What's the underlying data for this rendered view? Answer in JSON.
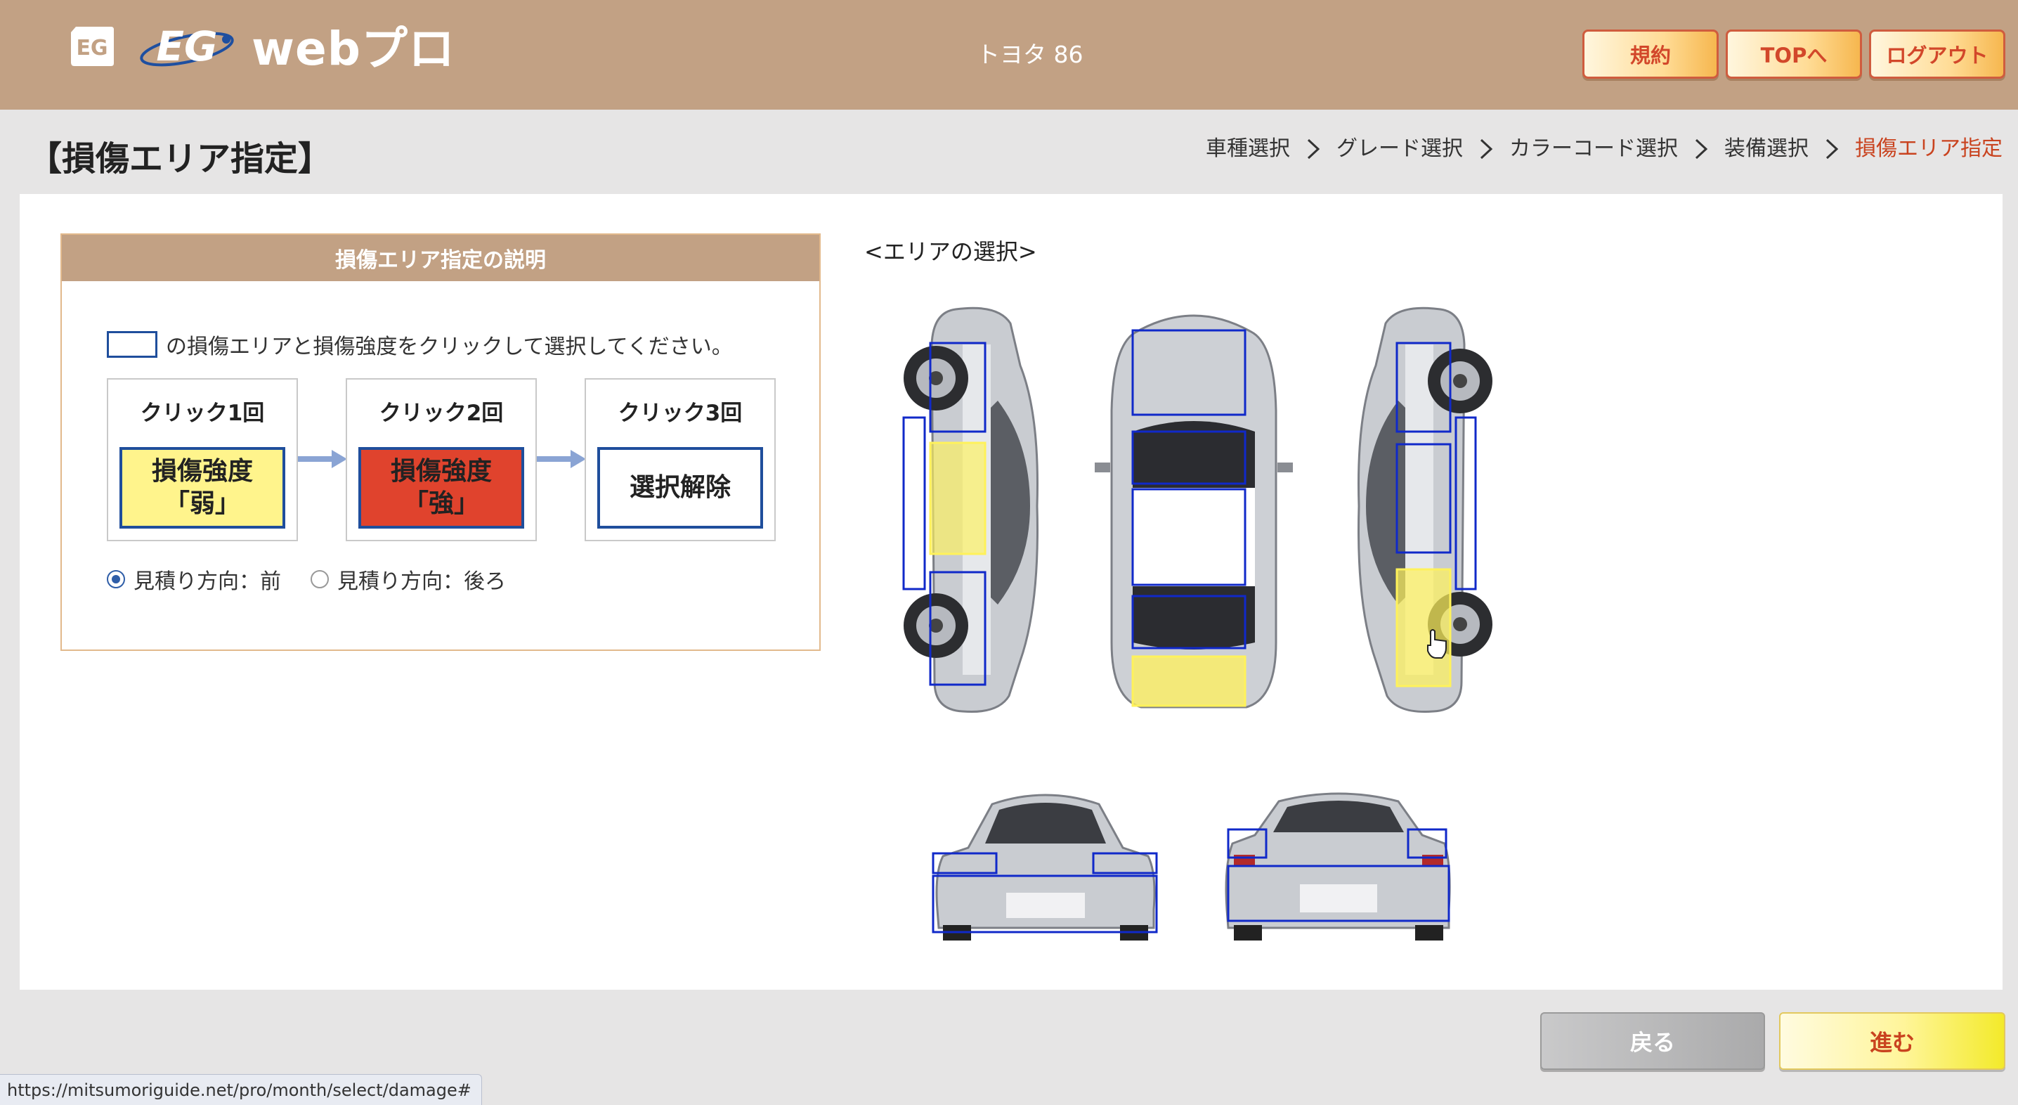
{
  "header": {
    "logo_text": "webプロ",
    "car_name": "トヨタ 86",
    "buttons": {
      "terms": "規約",
      "top": "TOPへ",
      "logout": "ログアウト"
    }
  },
  "page": {
    "title": "【損傷エリア指定】",
    "breadcrumb": [
      "車種選択",
      "グレード選択",
      "カラーコード選択",
      "装備選択",
      "損傷エリア指定"
    ]
  },
  "explanation": {
    "heading": "損傷エリア指定の説明",
    "instruction": "の損傷エリアと損傷強度をクリックして選択してください。",
    "steps": [
      {
        "label": "クリック1回",
        "line1": "損傷強度",
        "line2": "「弱」",
        "color": "#fff48c"
      },
      {
        "label": "クリック2回",
        "line1": "損傷強度",
        "line2": "「強」",
        "color": "#e0432d"
      },
      {
        "label": "クリック3回",
        "line1": "選択解除",
        "line2": "",
        "color": "#ffffff"
      }
    ],
    "direction_options": [
      {
        "label": "見積り方向：前",
        "selected": true
      },
      {
        "label": "見積り方向：後ろ",
        "selected": false
      }
    ]
  },
  "area_select": {
    "title": "<エリアの選択>",
    "zone_border_color": "#1029c9",
    "weak_damage_color": "#fff25a"
  },
  "footer": {
    "back": "戻る",
    "next": "進む",
    "status_url": "https://mitsumoriguide.net/pro/month/select/damage#"
  }
}
